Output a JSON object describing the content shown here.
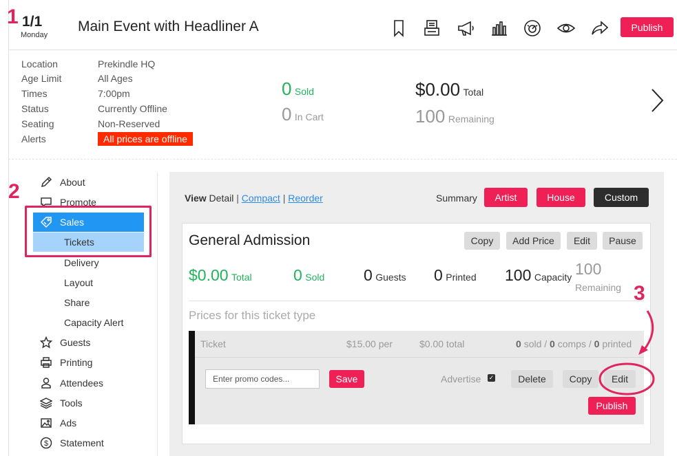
{
  "header": {
    "date": "1/1",
    "day": "Monday",
    "title": "Main Event with Headliner A",
    "publish_label": "Publish",
    "icons": [
      "bookmark-icon",
      "register-icon",
      "megaphone-icon",
      "bar-chart-icon",
      "dashboard-icon",
      "eye-icon",
      "share-icon"
    ]
  },
  "info": {
    "rows": [
      {
        "label": "Location",
        "value": "Prekindle HQ"
      },
      {
        "label": "Age Limit",
        "value": "All Ages"
      },
      {
        "label": "Times",
        "value": "7:00pm"
      },
      {
        "label": "Status",
        "value": "Currently Offline"
      },
      {
        "label": "Seating",
        "value": "Non-Reserved"
      },
      {
        "label": "Alerts",
        "value": "All prices are offline"
      }
    ],
    "sold_count": "0",
    "sold_label": "Sold",
    "in_cart_count": "0",
    "in_cart_label": "In Cart",
    "total_amount": "$0.00",
    "total_label": "Total",
    "remaining_count": "100",
    "remaining_label": "Remaining"
  },
  "sidebar": {
    "items": [
      {
        "label": "About",
        "icon": "pencil-icon"
      },
      {
        "label": "Promote",
        "icon": "chat-icon"
      },
      {
        "label": "Sales",
        "icon": "tag-icon"
      },
      {
        "label": "Tickets"
      },
      {
        "label": "Delivery"
      },
      {
        "label": "Layout"
      },
      {
        "label": "Share"
      },
      {
        "label": "Capacity Alert"
      },
      {
        "label": "Guests",
        "icon": "star-icon"
      },
      {
        "label": "Printing",
        "icon": "printer-icon"
      },
      {
        "label": "Attendees",
        "icon": "person-icon"
      },
      {
        "label": "Tools",
        "icon": "layers-icon"
      },
      {
        "label": "Ads",
        "icon": "image-icon"
      },
      {
        "label": "Statement",
        "icon": "dollar-icon"
      }
    ]
  },
  "annotations": [
    "1",
    "2",
    "3"
  ],
  "main": {
    "view_label": "View",
    "view_detail": "Detail",
    "sep1": "|",
    "view_compact": "Compact",
    "sep2": "|",
    "view_reorder": "Reorder",
    "summary_label": "Summary",
    "summary_buttons": [
      "Artist",
      "House",
      "Custom"
    ],
    "ticket_type": {
      "title": "General Admission",
      "actions": [
        "Copy",
        "Add Price",
        "Edit",
        "Pause"
      ],
      "total_amount": "$0.00",
      "total_label": "Total",
      "sold_count": "0",
      "sold_label": "Sold",
      "guests_count": "0",
      "guests_label": "Guests",
      "printed_count": "0",
      "printed_label": "Printed",
      "capacity_count": "100",
      "capacity_label": "Capacity",
      "remaining_count": "100",
      "remaining_label": "Remaining"
    },
    "prices_heading": "Prices for this ticket type",
    "price_row": {
      "name": "Ticket",
      "per_price": "$15.00 per",
      "total": "$0.00 total",
      "sold_n": "0",
      "sold_text": "sold /",
      "comps_n": "0",
      "comps_text": "comps /",
      "printed_n": "0",
      "printed_text": "printed",
      "promo_placeholder": "Enter promo codes...",
      "save_label": "Save",
      "advertise_label": "Advertise",
      "delete_label": "Delete",
      "copy_label": "Copy",
      "edit_label": "Edit",
      "publish_label": "Publish"
    }
  },
  "colors": {
    "accent_pink": "#ee2055",
    "sales_blue": "#2196f3",
    "tickets_light_blue": "#a6d3fb",
    "alert_red": "#ff2a00",
    "green": "#20b35a",
    "annotation": "#e0245e"
  }
}
